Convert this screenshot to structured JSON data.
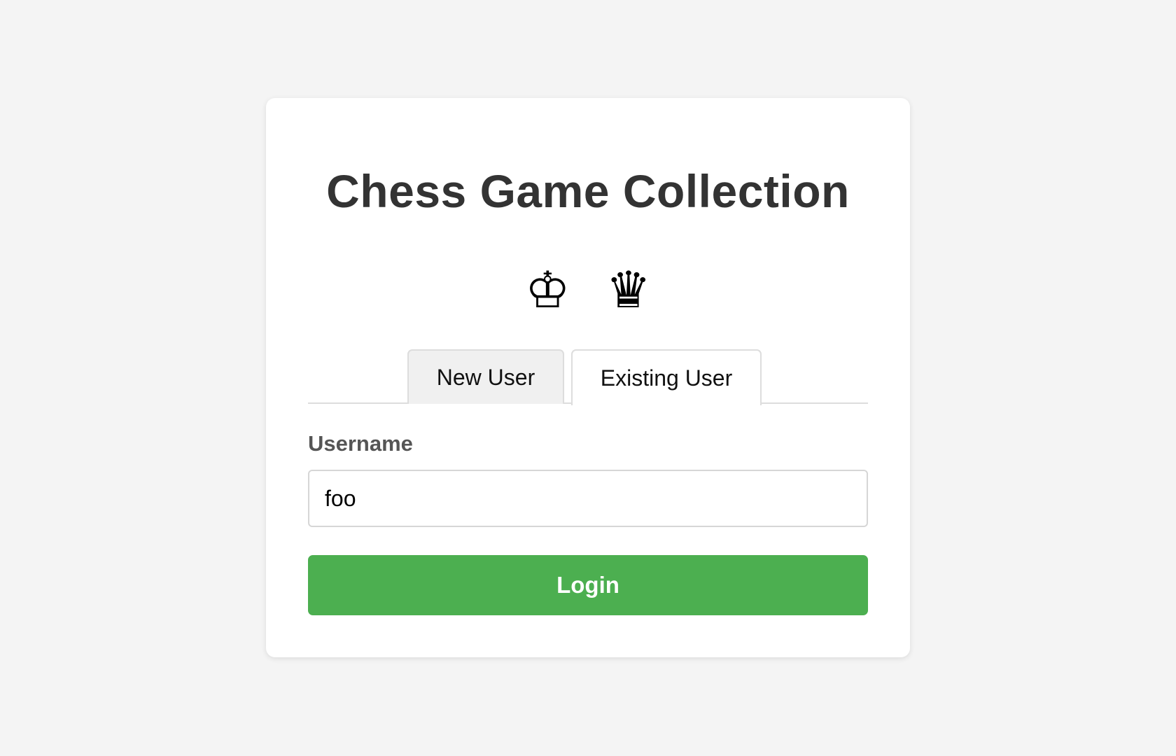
{
  "app": {
    "title": "Chess Game Collection",
    "pieces": {
      "king_icon": "king-icon",
      "king_glyph": "♔",
      "queen_icon": "queen-icon",
      "queen_glyph": "♛"
    }
  },
  "tabs": [
    {
      "label": "New User",
      "active": false
    },
    {
      "label": "Existing User",
      "active": true
    }
  ],
  "form": {
    "username_label": "Username",
    "username_value": "foo",
    "login_label": "Login"
  },
  "colors": {
    "background": "#f4f4f4",
    "card": "#ffffff",
    "title_text": "#333333",
    "label_text": "#555555",
    "login_button": "#4caf50",
    "inactive_tab": "#f0f0f0"
  }
}
